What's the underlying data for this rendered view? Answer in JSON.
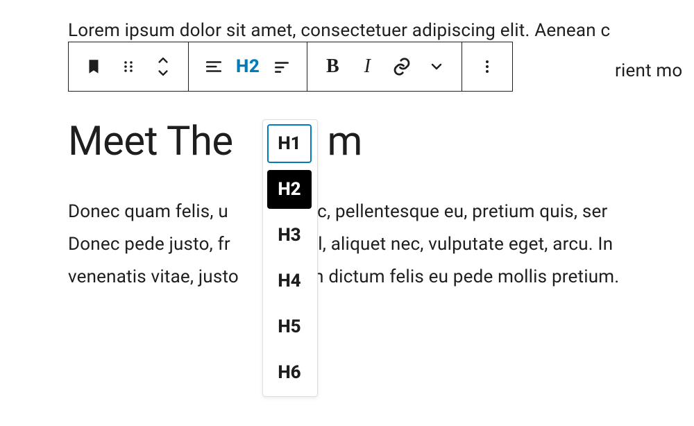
{
  "content": {
    "paragraph_top": "Lorem ipsum dolor sit amet, consectetuer adipiscing elit. Aenean c",
    "heading_before": "Meet The ",
    "heading_after": "m",
    "paragraph_body": "Donec quam felis, u               nec, pellentesque eu, pretium quis, ser\nDonec pede justo, fr               vel, aliquet nec, vulputate eget, arcu. In\nvenenatis vitae, justo               m dictum felis eu pede mollis pretium.",
    "paragraph_top_tail": "rient mo"
  },
  "toolbar": {
    "current_heading": "H2",
    "icons": {
      "block": "bookmark-icon",
      "drag": "drag-handle-icon",
      "move": "move-up-down-icon",
      "align": "align-left-icon",
      "heading_label": "H2",
      "line_menu": "line-spacing-icon",
      "bold": "bold-icon",
      "italic": "italic-icon",
      "link": "link-icon",
      "arrow": "chevron-down-icon",
      "more": "more-vertical-icon"
    }
  },
  "heading_menu": {
    "items": [
      {
        "label": "H1",
        "state": "outlined"
      },
      {
        "label": "H2",
        "state": "selected"
      },
      {
        "label": "H3",
        "state": "normal"
      },
      {
        "label": "H4",
        "state": "normal"
      },
      {
        "label": "H5",
        "state": "normal"
      },
      {
        "label": "H6",
        "state": "normal"
      }
    ]
  }
}
